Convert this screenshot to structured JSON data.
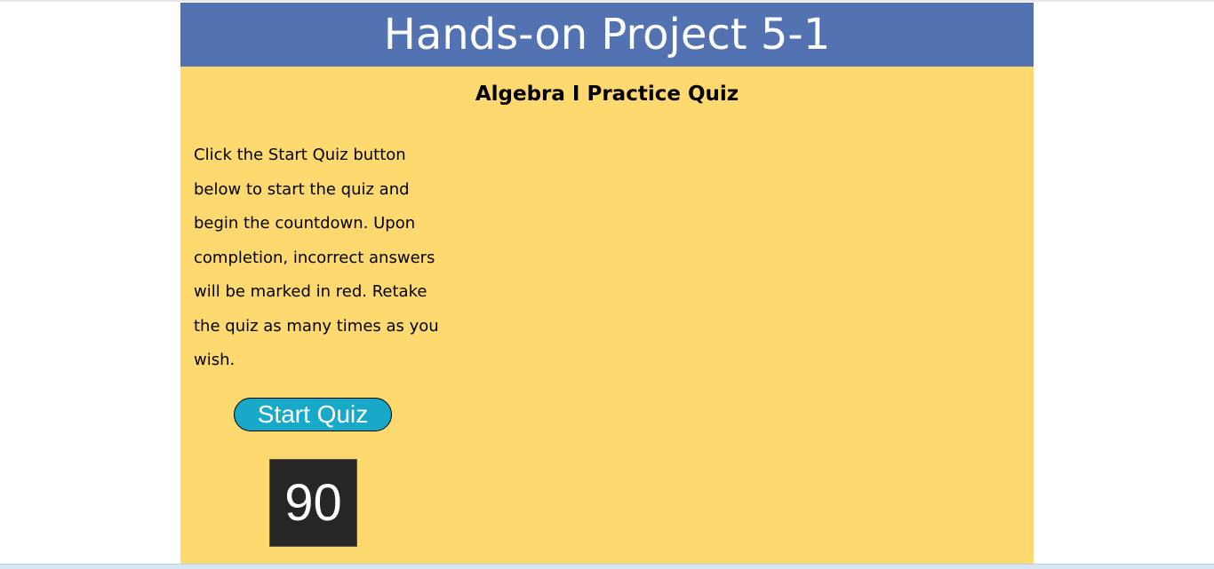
{
  "header": {
    "title": "Hands-on Project 5-1"
  },
  "main": {
    "subtitle": "Algebra I Practice Quiz",
    "instructions": "Click the Start Quiz button below to start the quiz and begin the countdown. Upon completion, incorrect answers will be marked in red. Retake the quiz as many times as you wish.",
    "start_button_label": "Start Quiz",
    "timer_value": "90"
  },
  "colors": {
    "header_background": "#5372b2",
    "page_background": "#fed970",
    "button_background": "#18a8c8",
    "timer_background": "#262626"
  }
}
